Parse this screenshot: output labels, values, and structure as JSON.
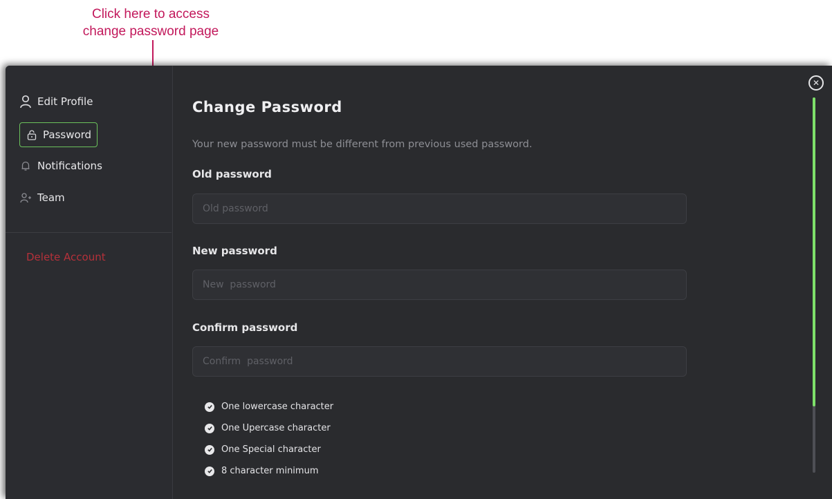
{
  "annotation": {
    "line1": "Click here to access",
    "line2": "change password page"
  },
  "sidebar": {
    "items": [
      {
        "label": "Edit Profile",
        "icon": "user-icon"
      },
      {
        "label": "Password",
        "icon": "lock-icon",
        "active": true
      },
      {
        "label": "Notifications",
        "icon": "bell-icon"
      },
      {
        "label": "Team",
        "icon": "add-user-icon"
      }
    ],
    "delete_label": "Delete Account"
  },
  "main": {
    "title": "Change Password",
    "subtitle": "Your new password must be different from previous used password.",
    "old_label": "Old password",
    "old_placeholder": "Old password",
    "new_label": "New password",
    "new_placeholder": "New  password",
    "confirm_label": "Confirm password",
    "confirm_placeholder": "Confirm  password",
    "requirements": [
      "One lowercase character",
      "One Upercase character",
      "One Special character",
      "8 character minimum"
    ]
  },
  "colors": {
    "accent": "#7ee06a",
    "annotation": "#c2185b",
    "danger": "#b5313a",
    "background": "#2a2b2e"
  }
}
